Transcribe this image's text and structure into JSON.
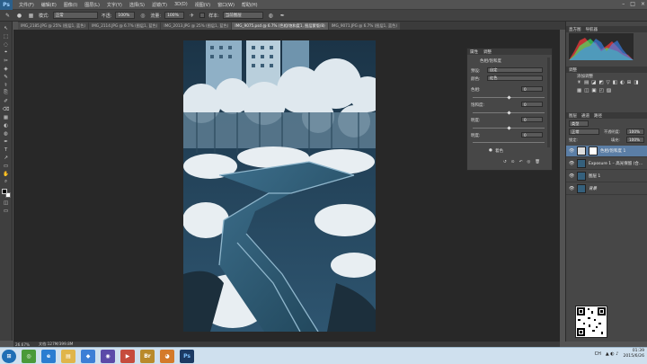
{
  "app": {
    "logo": "Ps"
  },
  "menu": [
    "文件(F)",
    "编辑(E)",
    "图像(I)",
    "图层(L)",
    "文字(Y)",
    "选择(S)",
    "滤镜(T)",
    "3D(D)",
    "视图(V)",
    "窗口(W)",
    "帮助(H)"
  ],
  "window_controls": [
    "–",
    "□",
    "×"
  ],
  "options": {
    "mode_label": "模式:",
    "mode_value": "正常",
    "opacity_label": "不透:",
    "opacity_value": "100%",
    "flow_label": "流量:",
    "flow_value": "100%",
    "sample_label": "样本:",
    "sample_value": "当前图层"
  },
  "tabs": [
    {
      "label": "IMG_2185.JPG @ 25% (图层1, 蓝色)",
      "active": false
    },
    {
      "label": "IMG_2114.JPG @ 6.7% (图层1, 蓝色)",
      "active": false
    },
    {
      "label": "IMG_2013.JPG @ 25% (图层1, 蓝色)",
      "active": false
    },
    {
      "label": "IMG_9075.psd @ 6.7% (色相/饱和度1, 图层蒙版/8)",
      "active": true
    },
    {
      "label": "IMG_9071.JPG @ 6.7% (图层1, 蓝色)",
      "active": false
    }
  ],
  "tools": [
    "↖",
    "⬚",
    "◌",
    "⌖",
    "✂",
    "◈",
    "✎",
    "⚕",
    "⎘",
    "✐",
    "⌫",
    "▦",
    "◐",
    "◍",
    "✒",
    "T",
    "↗",
    "▭",
    "✋",
    "⌕"
  ],
  "status": {
    "zoom": "26.67%",
    "doc": "文档:127M/399.8M"
  },
  "properties": {
    "tabs": [
      "属性",
      "调整"
    ],
    "title": "色相/饱和度",
    "preset_label": "预设:",
    "preset_value": "自定",
    "channel_label": "颜色:",
    "channel_value": "红色",
    "hue_label": "色相:",
    "hue_value": "0",
    "sat_label": "饱和度:",
    "sat_value": "0",
    "light_label": "明度:",
    "light_value": "0",
    "extra_label": "明度:",
    "extra_value": "0",
    "colorize_label": "着色",
    "colorize_icon": "●",
    "footer_icons": [
      "↺",
      "⊙",
      "↶",
      "◎",
      "🗑"
    ]
  },
  "histogram": {
    "tabs": [
      "直方图",
      "导航器"
    ],
    "colors": [
      "#ff3b3b",
      "#3bff6a",
      "#3b8cff",
      "#ffffff"
    ]
  },
  "adjustments": {
    "tabs": [
      "调整"
    ],
    "title": "添加调整",
    "icons": [
      "☀",
      "▤",
      "◪",
      "◩",
      "▽",
      "◧",
      "◐",
      "⊞",
      "◨",
      "▦",
      "◫",
      "▣",
      "◰",
      "▨"
    ]
  },
  "layers": {
    "tabs": [
      "图层",
      "通道",
      "路径"
    ],
    "kind_label": "类型",
    "blend_value": "正常",
    "opacity_label": "不透明度:",
    "opacity_value": "100%",
    "fill_label": "填充:",
    "fill_value": "100%",
    "lock_label": "锁定:",
    "items": [
      {
        "name": "色相/饱和度 1",
        "selected": true
      },
      {
        "name": "Exposure 1 – 高光保留 (合...",
        "selected": false
      },
      {
        "name": "图层 1",
        "selected": false
      },
      {
        "name": "背景",
        "selected": false
      }
    ],
    "footer_icons": [
      "⊕",
      "fx",
      "◎",
      "◍",
      "▢",
      "▤",
      "🗑"
    ]
  },
  "taskbar": {
    "apps": [
      {
        "icon": "start-orb",
        "color": "#1f6fb5",
        "glyph": "⊞"
      },
      {
        "icon": "chrome-icon",
        "color": "#4a9a3a",
        "glyph": "◎"
      },
      {
        "icon": "ie-icon",
        "color": "#2a7dd1",
        "glyph": "e"
      },
      {
        "icon": "explorer-icon",
        "color": "#e0b54a",
        "glyph": "▤"
      },
      {
        "icon": "app-icon",
        "color": "#3d7fd6",
        "glyph": "◆"
      },
      {
        "icon": "app-icon",
        "color": "#5b4aa8",
        "glyph": "◉"
      },
      {
        "icon": "app-icon",
        "color": "#c64c3d",
        "glyph": "▶"
      },
      {
        "icon": "bridge-icon",
        "color": "#b98a2b",
        "glyph": "Br"
      },
      {
        "icon": "app-icon",
        "color": "#d47a2a",
        "glyph": "◕"
      },
      {
        "icon": "photoshop-icon",
        "color": "#1c3a63",
        "glyph": "Ps"
      }
    ],
    "tray_lang": "CH",
    "time": "01:39",
    "date": "2015/6/26"
  }
}
